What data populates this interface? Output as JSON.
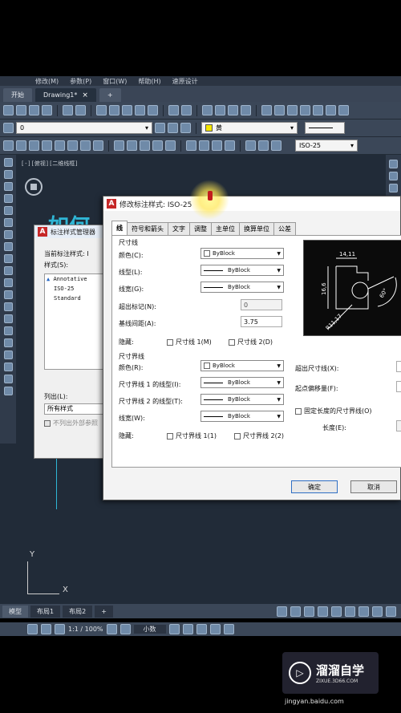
{
  "menu": {
    "items": [
      "修改(M)",
      "参数(P)",
      "窗口(W)",
      "帮助(H)",
      "速原设计"
    ]
  },
  "tabs": {
    "start": "开始",
    "drawing": "Drawing1*",
    "close": "×",
    "add": "+"
  },
  "toolbar": {
    "layer_value": "0",
    "color_value": "黄",
    "dimstyle_value": "ISO-25"
  },
  "viewport": {
    "label": "[-][俯视][二维线框]"
  },
  "manager_dialog": {
    "title": "标注样式管理器",
    "current_style_label": "当前标注样式: I",
    "styles_label": "样式(S):",
    "styles": [
      "Annotative",
      "ISO-25",
      "Standard"
    ],
    "list_label": "列出(L):",
    "list_value": "所有样式",
    "exclude_xref": "不列出外部参照"
  },
  "main_dialog": {
    "title": "修改标注样式: ISO-25",
    "tabs": [
      "线",
      "符号和箭头",
      "文字",
      "调整",
      "主单位",
      "换算单位",
      "公差"
    ],
    "dim_lines": {
      "group": "尺寸线",
      "color_label": "颜色(C):",
      "color_value": "ByBlock",
      "linetype_label": "线型(L):",
      "linetype_value": "ByBlock",
      "lineweight_label": "线宽(G):",
      "lineweight_value": "ByBlock",
      "extend_label": "超出标记(N):",
      "extend_value": "0",
      "baseline_label": "基线间距(A):",
      "baseline_value": "3.75",
      "suppress_label": "隐藏:",
      "suppress1": "尺寸线 1(M)",
      "suppress2": "尺寸线 2(D)"
    },
    "ext_lines": {
      "group": "尺寸界线",
      "color_label": "颜色(R):",
      "color_value": "ByBlock",
      "lt1_label": "尺寸界线 1 的线型(I):",
      "lt1_value": "ByBlock",
      "lt2_label": "尺寸界线 2 的线型(T):",
      "lt2_value": "ByBlock",
      "lineweight_label": "线宽(W):",
      "lineweight_value": "ByBlock",
      "suppress_label": "隐藏:",
      "suppress1": "尺寸界线 1(1)",
      "suppress2": "尺寸界线 2(2)",
      "extend_beyond_label": "超出尺寸线(X):",
      "offset_label": "起点偏移量(F):",
      "fixed_length_label": "固定长度的尺寸界线(O)",
      "length_label": "长度(E):"
    },
    "preview": {
      "dim_top": "14,11",
      "dim_left": "16,6",
      "dim_angle": "60°",
      "dim_radius": "R11,17"
    },
    "ok": "确定",
    "cancel": "取消"
  },
  "layout_tabs": [
    "模型",
    "布局1",
    "布局2",
    "+"
  ],
  "status": {
    "scale": "1:1 / 100%",
    "units": "小数"
  },
  "watermark": {
    "title": "溜溜自学",
    "subtitle": "ZIXUE.3D66.COM"
  },
  "source": "jingyan.baidu.com"
}
